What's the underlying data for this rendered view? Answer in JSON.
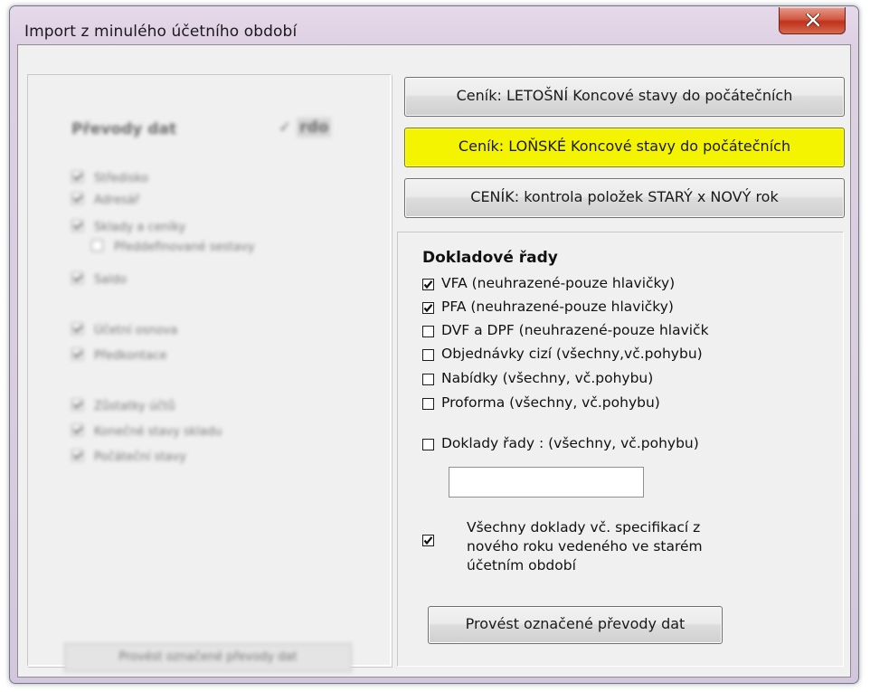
{
  "window": {
    "title": "Import z minulého účetního období"
  },
  "left_panel": {
    "heading": "Převody dat",
    "heading_right": "rdo",
    "items": [
      {
        "label": "Středisko",
        "checked": true
      },
      {
        "label": "Adresář",
        "checked": true
      },
      {
        "label": "Sklady a ceníky",
        "checked": true
      },
      {
        "label": "Předdefinované sestavy",
        "checked": false
      },
      {
        "label": "Saldo",
        "checked": true
      },
      {
        "label": "Účetní osnova",
        "checked": true
      },
      {
        "label": "Předkontace",
        "checked": true
      },
      {
        "label": "Zůstatky účtů",
        "checked": true
      },
      {
        "label": "Konečné stavy skladu",
        "checked": true
      },
      {
        "label": "Počáteční stavy",
        "checked": true
      }
    ],
    "bottom_button": "Provést označené převody dat"
  },
  "buttons": {
    "cenik_letosni": "Ceník: LETOŠNÍ Koncové stavy do počátečních",
    "cenik_lonske": "Ceník: LOŇSKÉ Koncové stavy do počátečních",
    "cenik_kontrola": "CENÍK: kontrola položek STARÝ x NOVÝ rok",
    "highlight_color": "#f4f400"
  },
  "doklady": {
    "heading": "Dokladové řady",
    "items": [
      {
        "label": "VFA (neuhrazené-pouze hlavičky)",
        "checked": true
      },
      {
        "label": "PFA (neuhrazené-pouze hlavičky)",
        "checked": true
      },
      {
        "label": "DVF a DPF (neuhrazené-pouze hlavičk",
        "checked": false
      },
      {
        "label": "Objednávky cizí (všechny,vč.pohybu)",
        "checked": false
      },
      {
        "label": "Nabídky (všechny, vč.pohybu)",
        "checked": false
      },
      {
        "label": "Proforma (všechny, vč.pohybu)",
        "checked": false
      }
    ],
    "doklady_rady": {
      "label": "Doklady řady : (všechny, vč.pohybu)",
      "checked": false,
      "value": ""
    },
    "vsechny_doklady": {
      "lines": [
        "Všechny doklady vč. specifikací z",
        "nového roku vedeného ve starém",
        "účetním období"
      ],
      "checked": true
    },
    "execute_button": "Provést označené převody dat"
  }
}
